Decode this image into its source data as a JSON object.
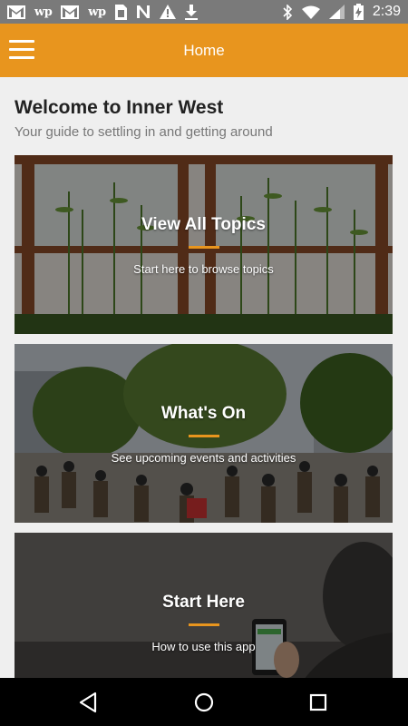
{
  "status_bar": {
    "notifications": [
      "gmail-icon",
      "washington-post-icon",
      "gmail-icon",
      "washington-post-icon",
      "sim-card-icon",
      "n-icon",
      "warning-icon",
      "download-icon"
    ],
    "wp_label": "wp",
    "n_label": "N",
    "system": [
      "bluetooth-icon",
      "wifi-icon",
      "signal-icon",
      "battery-charging-icon"
    ],
    "time": "2:39"
  },
  "app_bar": {
    "title": "Home",
    "menu_icon": "hamburger-icon",
    "color": "#e8951e"
  },
  "header": {
    "title": "Welcome to Inner West",
    "subtitle": "Your guide to settling in and getting around"
  },
  "cards": [
    {
      "title": "View All Topics",
      "subtitle": "Start here to browse topics"
    },
    {
      "title": "What's On",
      "subtitle": "See upcoming events and activities"
    },
    {
      "title": "Start Here",
      "subtitle": "How to use this app"
    }
  ],
  "nav_bar": {
    "buttons": [
      "back-icon",
      "home-icon",
      "recent-apps-icon"
    ]
  }
}
